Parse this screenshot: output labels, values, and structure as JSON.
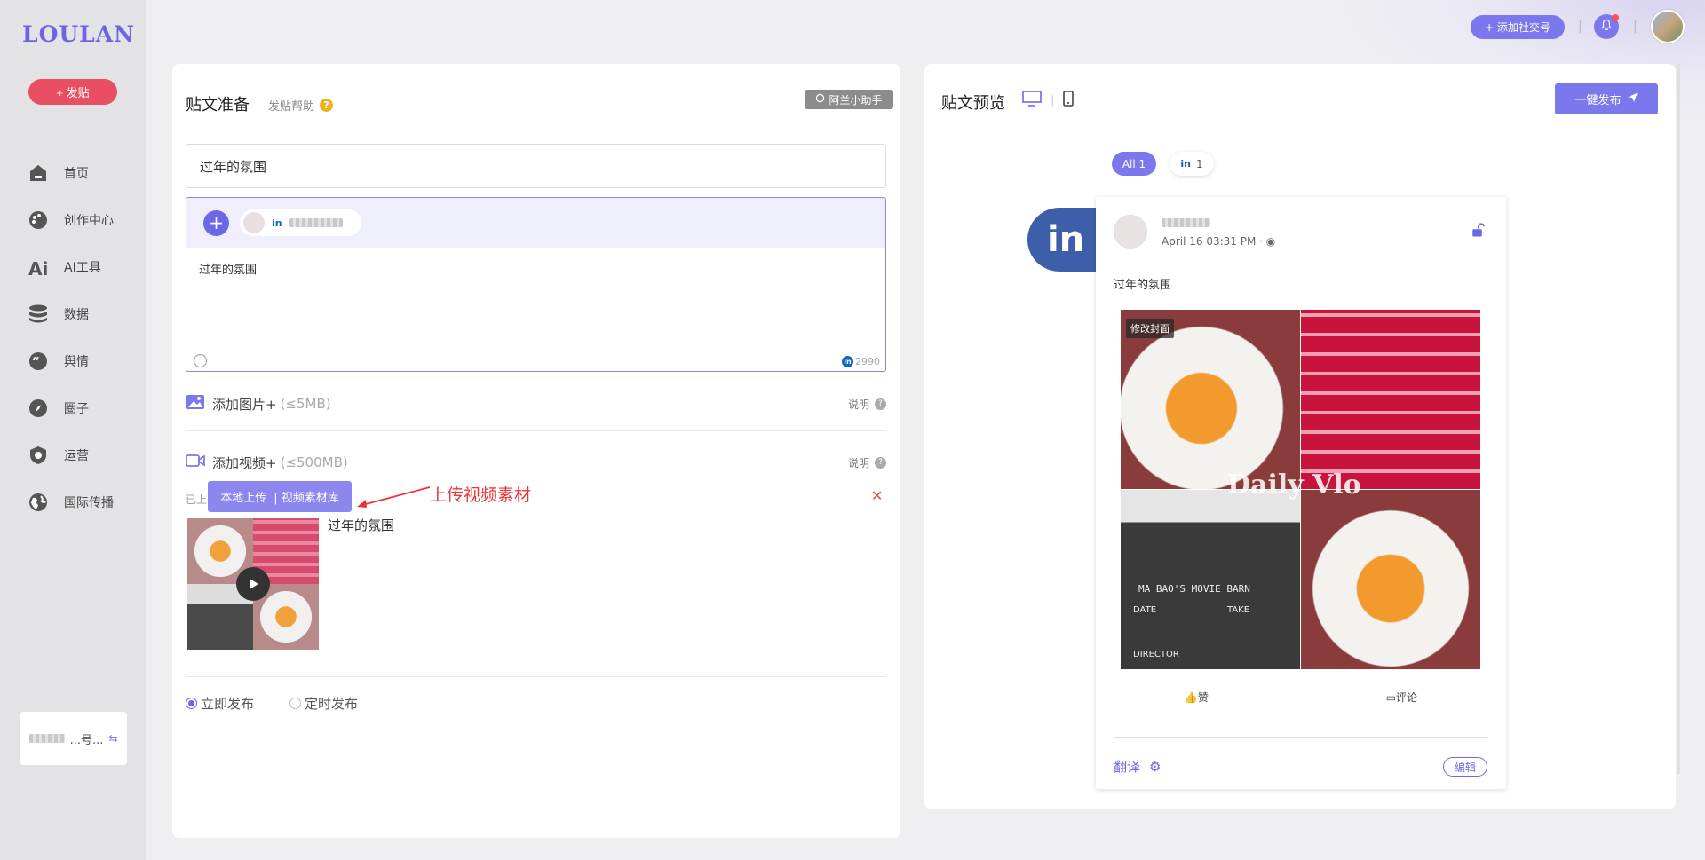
{
  "brand": {
    "logo": "LOULAN",
    "accent": "#7b78ee",
    "post_btn_color": "#e94e63"
  },
  "sidebar": {
    "post_button": "+ 发贴",
    "items": [
      {
        "label": "首页",
        "icon": "home-icon"
      },
      {
        "label": "创作中心",
        "icon": "palette-icon"
      },
      {
        "label": "AI工具",
        "icon": "ai-icon"
      },
      {
        "label": "数据",
        "icon": "database-icon"
      },
      {
        "label": "舆情",
        "icon": "quote-icon"
      },
      {
        "label": "圈子",
        "icon": "compass-icon"
      },
      {
        "label": "运营",
        "icon": "shield-icon"
      },
      {
        "label": "国际传播",
        "icon": "globe-icon"
      }
    ],
    "account_card_text": "...号..."
  },
  "topbar": {
    "add_social": "+ 添加社交号",
    "separator": "|"
  },
  "compose": {
    "title": "贴文准备",
    "help": "发贴帮助",
    "help_mark": "?",
    "assistant": "阿兰小助手",
    "title_value": "过年的氛围",
    "account_chip": "in",
    "body_text": "过年的氛围",
    "char_count": "2990",
    "add_image": "添加图片+",
    "add_image_hint": "(≤5MB)",
    "add_video": "添加视频+",
    "add_video_hint": "(≤500MB)",
    "explain": "说明",
    "uploaded_label": "已上",
    "upload_local": "本地上传",
    "upload_library": "| 视频素材库",
    "annotation": "上传视频素材",
    "video_title": "过年的氛围",
    "publish_now": "立即发布",
    "publish_scheduled": "定时发布"
  },
  "preview": {
    "title": "贴文预览",
    "publish_all": "一键发布",
    "filter_all": "All 1",
    "filter_li_count": "1",
    "li_badge": "in",
    "post_time": "April 16 03:31 PM ·",
    "post_text": "过年的氛围",
    "cover_tag": "修改封面",
    "watermark": "Daily Vlo",
    "clapper_text": "MA BAO'S MOVIE BARN",
    "clapper_date": "DATE",
    "clapper_take": "TAKE",
    "clapper_director": "DIRECTOR",
    "like": "赞",
    "comment": "评论",
    "translate": "翻译",
    "edit": "编辑"
  }
}
